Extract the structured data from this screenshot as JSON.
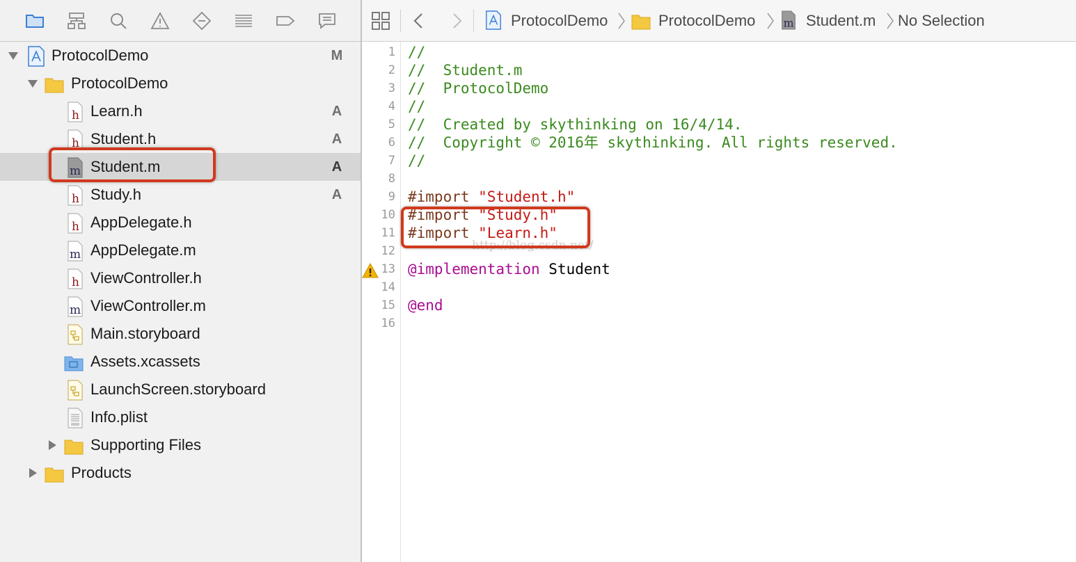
{
  "navigator": {
    "toolbar_icons": [
      "folder-icon",
      "hierarchy-icon",
      "search-icon",
      "warning-icon",
      "breakpoint-diamond-icon",
      "list-icon",
      "tag-icon",
      "speech-bubble-icon"
    ],
    "tree": [
      {
        "name": "ProtocolDemo",
        "type": "project",
        "level": 0,
        "expanded": true,
        "status": "M"
      },
      {
        "name": "ProtocolDemo",
        "type": "folder",
        "level": 1,
        "expanded": true,
        "status": ""
      },
      {
        "name": "Learn.h",
        "type": "h",
        "level": 2,
        "status": "A"
      },
      {
        "name": "Student.h",
        "type": "h",
        "level": 2,
        "status": "A"
      },
      {
        "name": "Student.m",
        "type": "m",
        "level": 2,
        "status": "A",
        "selected": true
      },
      {
        "name": "Study.h",
        "type": "h",
        "level": 2,
        "status": "A"
      },
      {
        "name": "AppDelegate.h",
        "type": "h",
        "level": 2,
        "status": ""
      },
      {
        "name": "AppDelegate.m",
        "type": "m",
        "level": 2,
        "status": ""
      },
      {
        "name": "ViewController.h",
        "type": "h",
        "level": 2,
        "status": ""
      },
      {
        "name": "ViewController.m",
        "type": "m",
        "level": 2,
        "status": ""
      },
      {
        "name": "Main.storyboard",
        "type": "storyboard",
        "level": 2,
        "status": ""
      },
      {
        "name": "Assets.xcassets",
        "type": "assets",
        "level": 2,
        "status": ""
      },
      {
        "name": "LaunchScreen.storyboard",
        "type": "storyboard",
        "level": 2,
        "status": ""
      },
      {
        "name": "Info.plist",
        "type": "plist",
        "level": 2,
        "status": ""
      },
      {
        "name": "Supporting Files",
        "type": "folder",
        "level": 2,
        "expanded": false,
        "status": ""
      },
      {
        "name": "Products",
        "type": "folder",
        "level": 1,
        "expanded": false,
        "status": ""
      }
    ]
  },
  "jump_bar": {
    "crumbs": [
      "ProtocolDemo",
      "ProtocolDemo",
      "Student.m",
      "No Selection"
    ]
  },
  "editor": {
    "lines": [
      {
        "n": "1",
        "parts": [
          {
            "t": "//",
            "c": "comment"
          }
        ]
      },
      {
        "n": "2",
        "parts": [
          {
            "t": "//  Student.m",
            "c": "comment"
          }
        ]
      },
      {
        "n": "3",
        "parts": [
          {
            "t": "//  ProtocolDemo",
            "c": "comment"
          }
        ]
      },
      {
        "n": "4",
        "parts": [
          {
            "t": "//",
            "c": "comment"
          }
        ]
      },
      {
        "n": "5",
        "parts": [
          {
            "t": "//  Created by skythinking on 16/4/14.",
            "c": "comment"
          }
        ]
      },
      {
        "n": "6",
        "parts": [
          {
            "t": "//  Copyright © 2016年 skythinking. All rights reserved.",
            "c": "comment"
          }
        ]
      },
      {
        "n": "7",
        "parts": [
          {
            "t": "//",
            "c": "comment"
          }
        ]
      },
      {
        "n": "8",
        "parts": []
      },
      {
        "n": "9",
        "parts": [
          {
            "t": "#import ",
            "c": "pre"
          },
          {
            "t": "\"Student.h\"",
            "c": "str"
          }
        ]
      },
      {
        "n": "10",
        "parts": [
          {
            "t": "#import ",
            "c": "pre"
          },
          {
            "t": "\"Study.h\"",
            "c": "str"
          }
        ]
      },
      {
        "n": "11",
        "parts": [
          {
            "t": "#import ",
            "c": "pre"
          },
          {
            "t": "\"Learn.h\"",
            "c": "str"
          }
        ]
      },
      {
        "n": "12",
        "parts": []
      },
      {
        "n": "13",
        "parts": [
          {
            "t": "@implementation",
            "c": "kw"
          },
          {
            "t": " Student",
            "c": "plain"
          }
        ],
        "warning": true
      },
      {
        "n": "14",
        "parts": []
      },
      {
        "n": "15",
        "parts": [
          {
            "t": "@end",
            "c": "kw"
          }
        ]
      },
      {
        "n": "16",
        "parts": []
      }
    ],
    "watermark": "http://blog.csdn.net/"
  },
  "colors": {
    "highlight_box": "#d0391d",
    "comment": "#3a8a1e",
    "keyword": "#aa0d91",
    "string": "#c41a16",
    "folder": "#f5c842"
  }
}
